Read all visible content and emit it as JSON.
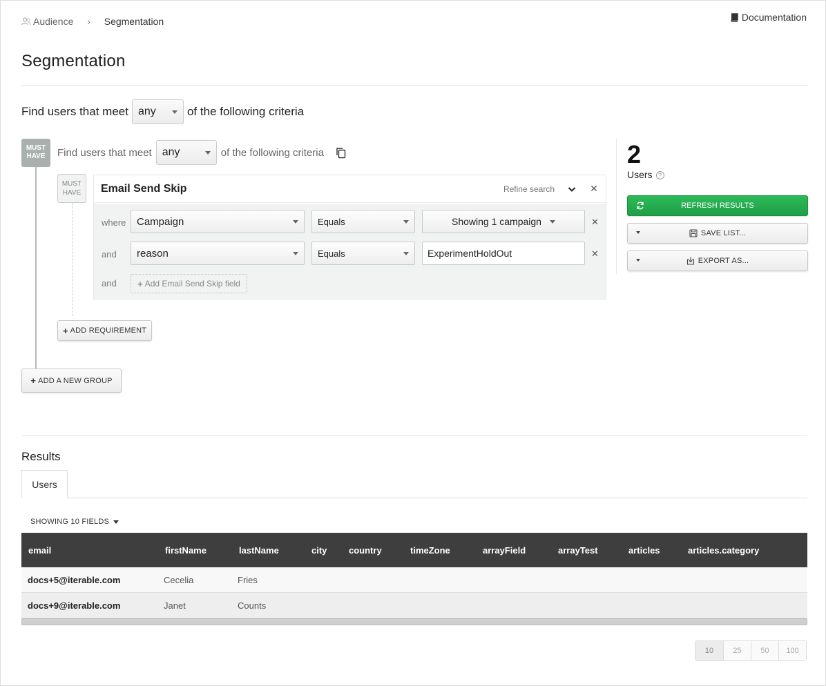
{
  "breadcrumb": {
    "parent": "Audience",
    "current": "Segmentation"
  },
  "documentation_link": "Documentation",
  "page_title": "Segmentation",
  "outer_criteria": {
    "prefix": "Find users that meet",
    "match": "any",
    "suffix": "of the following criteria"
  },
  "group": {
    "badge_line1": "MUST",
    "badge_line2": "HAVE",
    "criteria": {
      "prefix": "Find users that meet",
      "match": "any",
      "suffix": "of the following criteria"
    },
    "requirement": {
      "badge_line1": "MUST",
      "badge_line2": "HAVE",
      "title": "Email Send Skip",
      "refine_label": "Refine search",
      "rows": [
        {
          "connector": "where",
          "field": "Campaign",
          "operator": "Equals",
          "value": "Showing 1 campaign"
        },
        {
          "connector": "and",
          "field": "reason",
          "operator": "Equals",
          "value": "ExperimentHoldOut"
        }
      ],
      "add_field": {
        "connector": "and",
        "label": "Add Email Send Skip field"
      }
    },
    "add_requirement_label": "ADD REQUIREMENT"
  },
  "add_group_label": "ADD A NEW GROUP",
  "summary": {
    "count": "2",
    "label": "Users",
    "refresh_label": "REFRESH RESULTS",
    "save_label": "SAVE LIST...",
    "export_label": "EXPORT AS..."
  },
  "colors": {
    "accent_green": "#22a84e",
    "table_header": "#3e3e3e"
  },
  "results": {
    "title": "Results",
    "tab": "Users",
    "showing_fields": "SHOWING 10 FIELDS",
    "columns": [
      "email",
      "firstName",
      "lastName",
      "city",
      "country",
      "timeZone",
      "arrayField",
      "arrayTest",
      "articles",
      "articles.category"
    ],
    "rows": [
      {
        "email": "docs+5@iterable.com",
        "firstName": "Cecelia",
        "lastName": "Fries"
      },
      {
        "email": "docs+9@iterable.com",
        "firstName": "Janet",
        "lastName": "Counts"
      }
    ],
    "page_sizes": [
      "10",
      "25",
      "50",
      "100"
    ]
  }
}
